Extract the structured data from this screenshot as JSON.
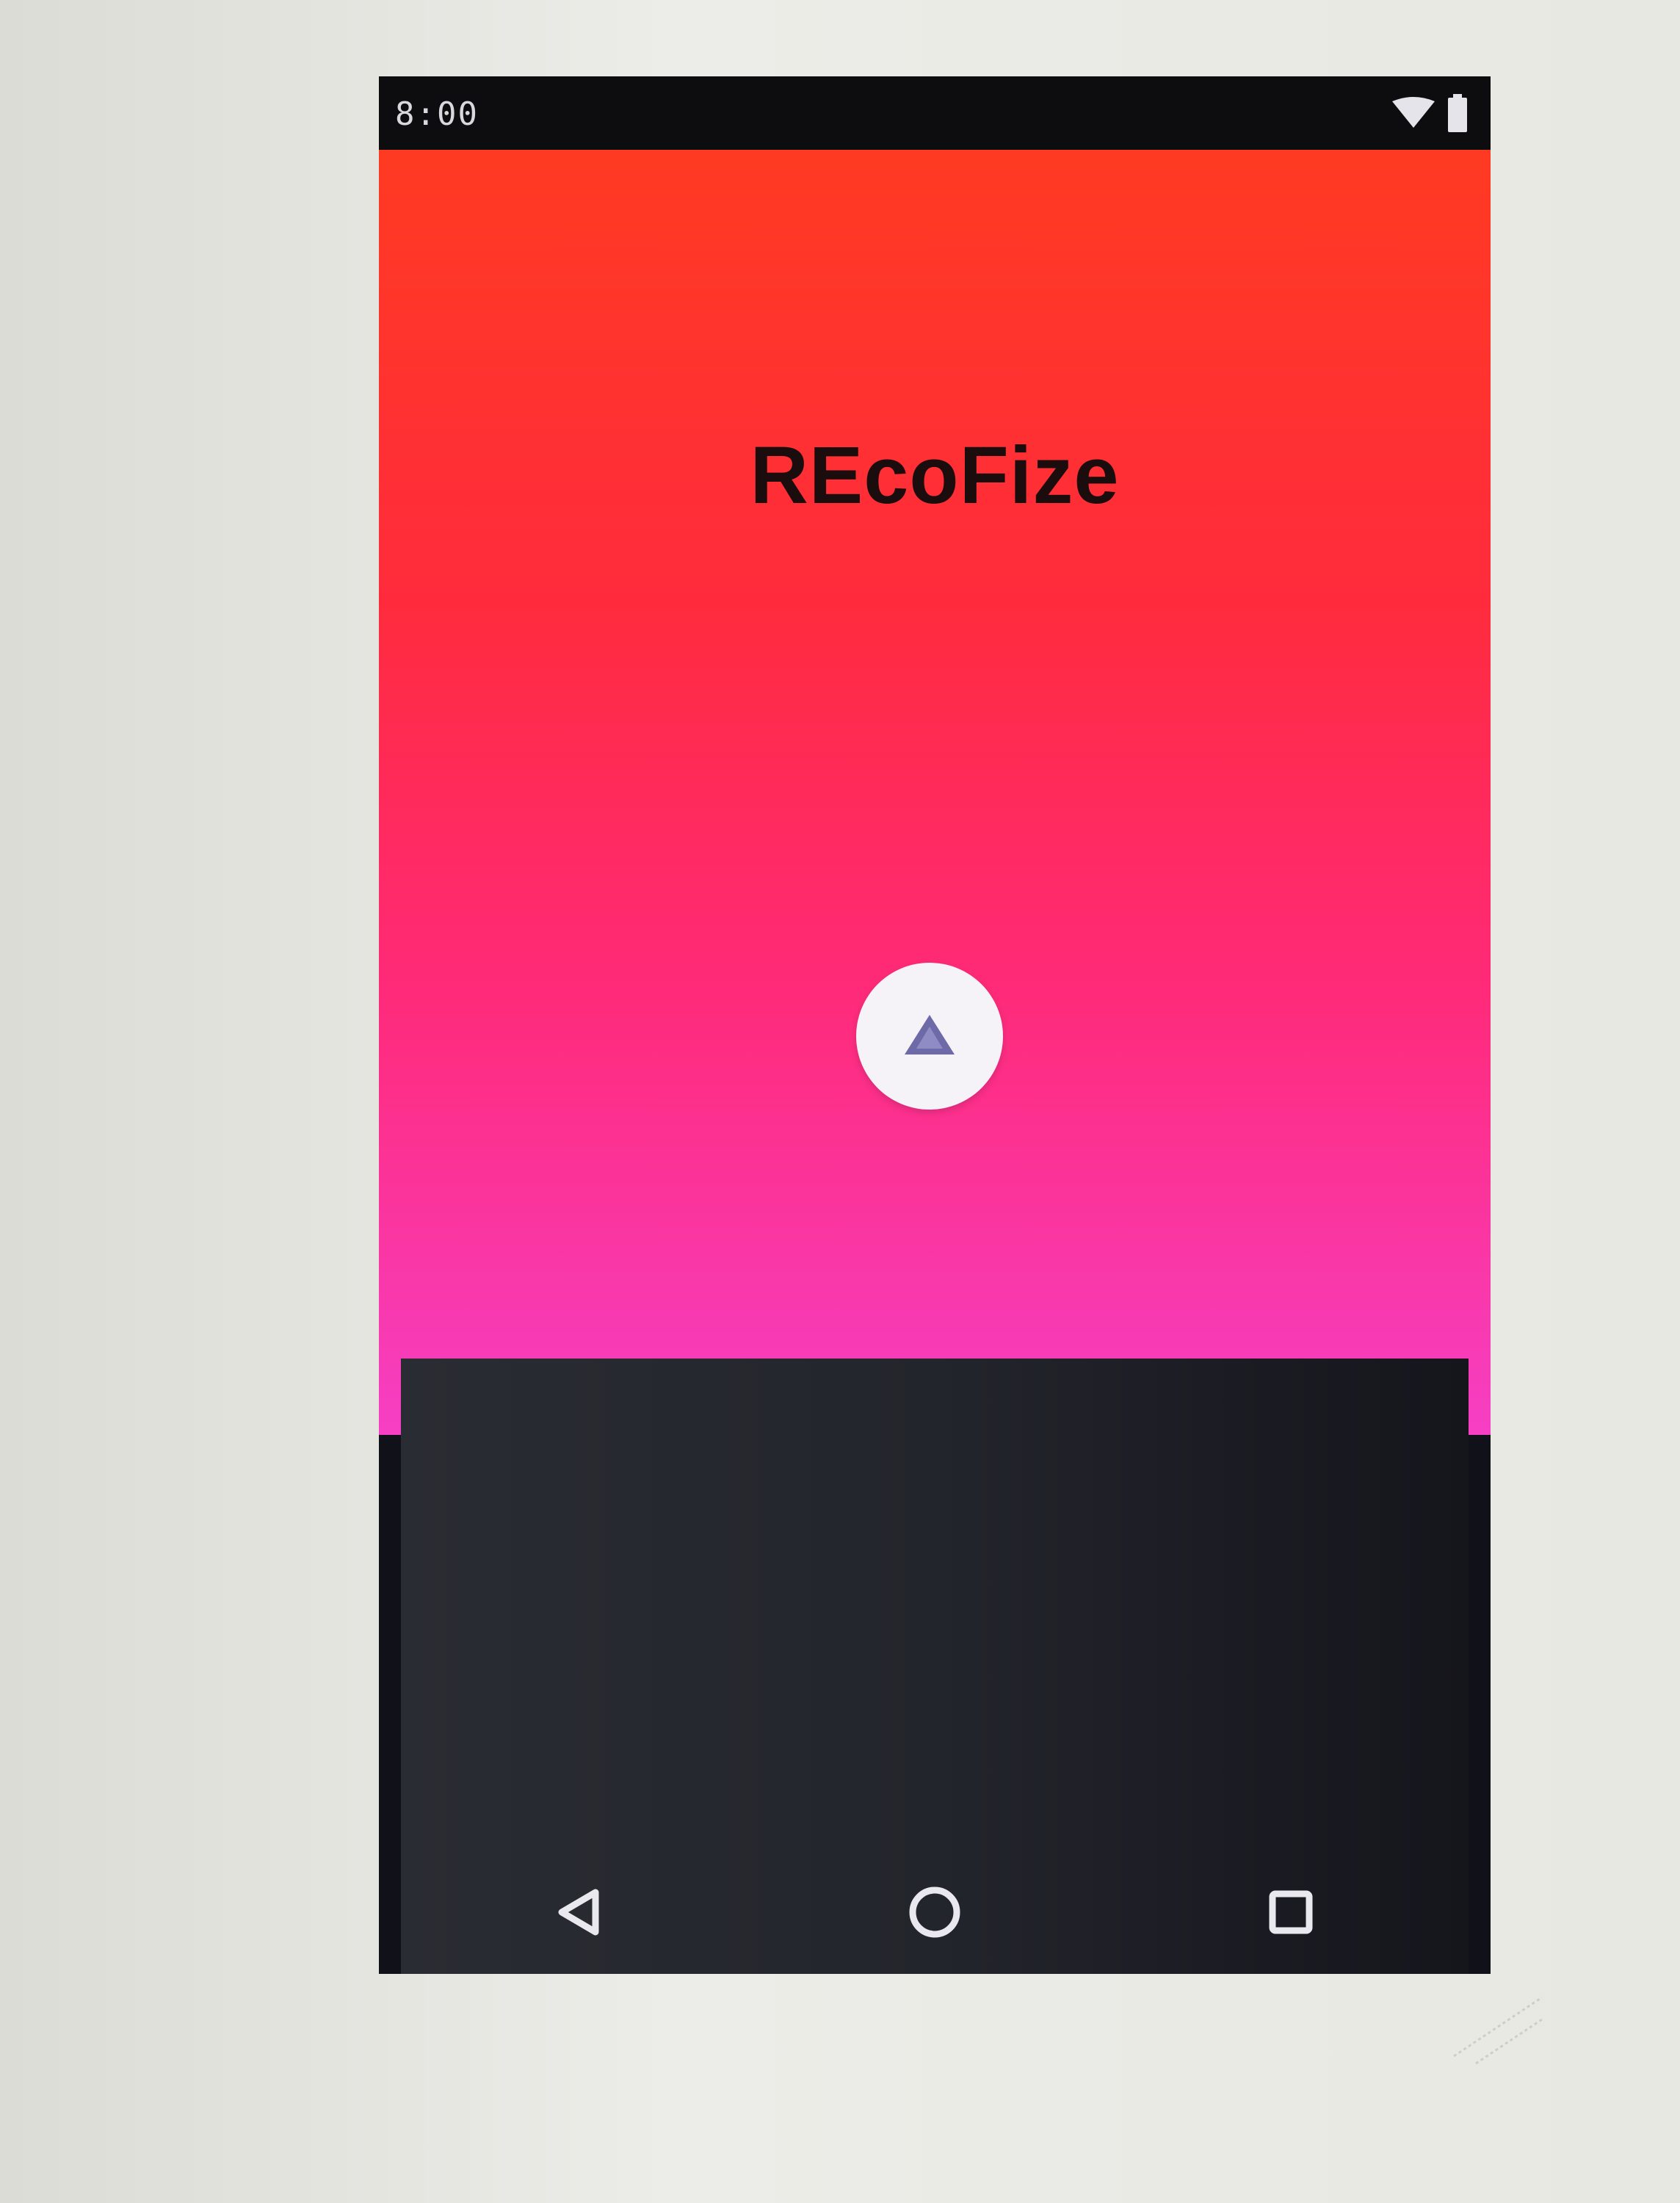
{
  "status_bar": {
    "time": "8:00"
  },
  "app": {
    "title": "REcoFize"
  },
  "colors": {
    "gradient_top": "#ff3a22",
    "gradient_middle": "#ff2a78",
    "gradient_bottom": "#f63fc4",
    "dark_panel": "#23252c",
    "play_button_bg": "#f5f2f8",
    "play_icon": "#6e6aa8"
  },
  "icons": {
    "play": "play-icon",
    "wifi": "wifi-icon",
    "battery": "battery-icon",
    "back": "back-icon",
    "home": "home-icon",
    "recents": "recents-icon"
  }
}
